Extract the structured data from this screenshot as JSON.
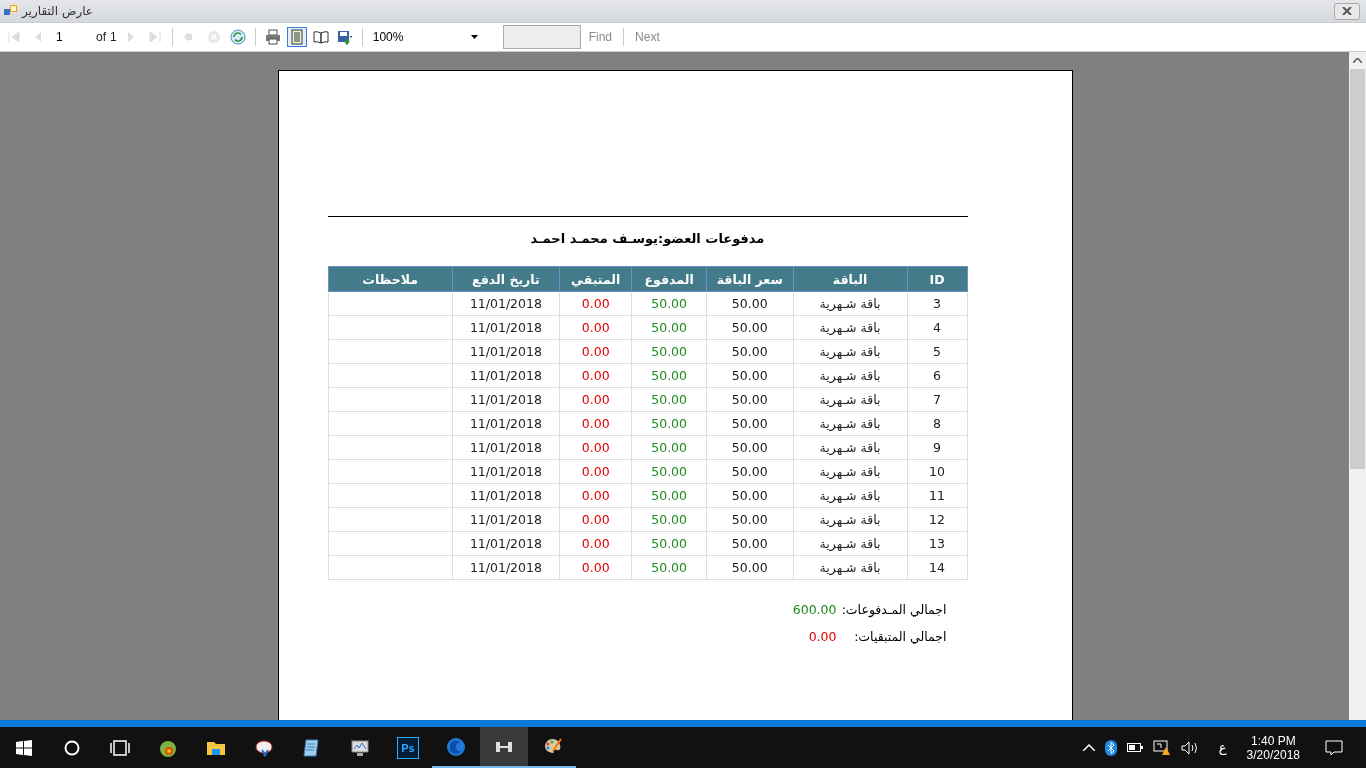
{
  "window": {
    "title": "عارض التقارير"
  },
  "toolbar": {
    "nav_buttons": [
      {
        "kind": "first",
        "disabled": true
      },
      {
        "kind": "prev",
        "disabled": true
      }
    ],
    "page": "1",
    "of_label": "of",
    "page_count": "1",
    "nav_buttons_after": [
      {
        "kind": "next",
        "disabled": true
      },
      {
        "kind": "last",
        "disabled": true
      }
    ],
    "action_buttons": [
      {
        "kind": "back",
        "disabled": true
      },
      {
        "kind": "stop",
        "disabled": true
      },
      {
        "kind": "refresh",
        "disabled": false
      }
    ],
    "view_buttons": [
      {
        "kind": "print",
        "selected": false
      },
      {
        "kind": "layout",
        "selected": true
      },
      {
        "kind": "setup",
        "selected": false
      },
      {
        "kind": "export",
        "selected": false
      }
    ],
    "zoom": "100%",
    "find_label": "Find",
    "next_label": "Next"
  },
  "report": {
    "title": "مدفوعات العضو:يوسـف محمـد احمـد",
    "columns": [
      "ID",
      "الباقة",
      "سعر الباقة",
      "المدفوع",
      "المتبقي",
      "تاريخ  الدفع",
      "ملاحظات"
    ],
    "rows": [
      {
        "id": "3",
        "package": "باقة شـهرية",
        "price": "50.00",
        "paid": "50.00",
        "remaining": "0.00",
        "date": "11/01/2018"
      },
      {
        "id": "4",
        "package": "باقة شـهرية",
        "price": "50.00",
        "paid": "50.00",
        "remaining": "0.00",
        "date": "11/01/2018"
      },
      {
        "id": "5",
        "package": "باقة شـهرية",
        "price": "50.00",
        "paid": "50.00",
        "remaining": "0.00",
        "date": "11/01/2018"
      },
      {
        "id": "6",
        "package": "باقة شـهرية",
        "price": "50.00",
        "paid": "50.00",
        "remaining": "0.00",
        "date": "11/01/2018"
      },
      {
        "id": "7",
        "package": "باقة شـهرية",
        "price": "50.00",
        "paid": "50.00",
        "remaining": "0.00",
        "date": "11/01/2018"
      },
      {
        "id": "8",
        "package": "باقة شـهرية",
        "price": "50.00",
        "paid": "50.00",
        "remaining": "0.00",
        "date": "11/01/2018"
      },
      {
        "id": "9",
        "package": "باقة شـهرية",
        "price": "50.00",
        "paid": "50.00",
        "remaining": "0.00",
        "date": "11/01/2018"
      },
      {
        "id": "10",
        "package": "باقة شـهرية",
        "price": "50.00",
        "paid": "50.00",
        "remaining": "0.00",
        "date": "11/01/2018"
      },
      {
        "id": "11",
        "package": "باقة شـهرية",
        "price": "50.00",
        "paid": "50.00",
        "remaining": "0.00",
        "date": "11/01/2018"
      },
      {
        "id": "12",
        "package": "باقة شـهرية",
        "price": "50.00",
        "paid": "50.00",
        "remaining": "0.00",
        "date": "11/01/2018"
      },
      {
        "id": "13",
        "package": "باقة شـهرية",
        "price": "50.00",
        "paid": "50.00",
        "remaining": "0.00",
        "date": "11/01/2018"
      },
      {
        "id": "14",
        "package": "باقة شـهرية",
        "price": "50.00",
        "paid": "50.00",
        "remaining": "0.00",
        "date": "11/01/2018"
      }
    ],
    "totals": [
      {
        "label": "اجمالي المـدفوعات:",
        "value": "600.00",
        "kind": "paid"
      },
      {
        "label": "اجمالي المتبقيات:",
        "value": "0.00",
        "kind": "remaining"
      }
    ]
  },
  "taskbar": {
    "apps": [
      {
        "kind": "chameleon",
        "running": false,
        "active": false
      },
      {
        "kind": "folder",
        "running": false,
        "active": false
      },
      {
        "kind": "paint",
        "running": false,
        "active": false
      },
      {
        "kind": "notepad",
        "running": false,
        "active": false
      },
      {
        "kind": "monitor",
        "running": false,
        "active": false
      },
      {
        "kind": "ps",
        "label": "Ps",
        "running": false,
        "active": false
      },
      {
        "kind": "firefox",
        "running": true,
        "active": false
      },
      {
        "kind": "dumbbell",
        "running": true,
        "active": true
      },
      {
        "kind": "palette",
        "running": true,
        "active": false
      }
    ],
    "language": "ع",
    "time": "1:40 PM",
    "date": "3/20/2018"
  }
}
